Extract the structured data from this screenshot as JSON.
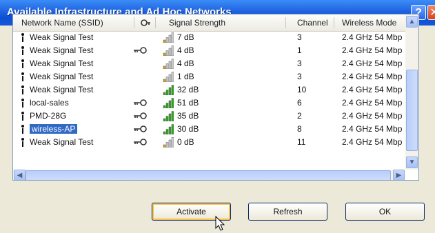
{
  "window": {
    "title": "Available Infrastructure and Ad Hoc Networks",
    "help_label": "?",
    "close_label": "✕"
  },
  "columns": {
    "ssid": "Network Name (SSID)",
    "signal": "Signal Strength",
    "channel": "Channel",
    "mode": "Wireless Mode"
  },
  "networks": [
    {
      "ssid": "Weak Signal Test",
      "secured": false,
      "signal": "7 dB",
      "level": 0.25,
      "strong": false,
      "channel": "3",
      "mode": "2.4 GHz 54 Mbp"
    },
    {
      "ssid": "Weak Signal Test",
      "secured": true,
      "signal": "4 dB",
      "level": 0.25,
      "strong": false,
      "channel": "1",
      "mode": "2.4 GHz 54 Mbp"
    },
    {
      "ssid": "Weak Signal Test",
      "secured": false,
      "signal": "4 dB",
      "level": 0.25,
      "strong": false,
      "channel": "3",
      "mode": "2.4 GHz 54 Mbp"
    },
    {
      "ssid": "Weak Signal Test",
      "secured": false,
      "signal": "1 dB",
      "level": 0.25,
      "strong": false,
      "channel": "3",
      "mode": "2.4 GHz 54 Mbp"
    },
    {
      "ssid": "Weak Signal Test",
      "secured": false,
      "signal": "32 dB",
      "level": 1,
      "strong": true,
      "channel": "10",
      "mode": "2.4 GHz 54 Mbp"
    },
    {
      "ssid": "local-sales",
      "secured": true,
      "signal": "51 dB",
      "level": 1,
      "strong": true,
      "channel": "6",
      "mode": "2.4 GHz 54 Mbp"
    },
    {
      "ssid": "PMD-28G",
      "secured": true,
      "signal": "35 dB",
      "level": 1,
      "strong": true,
      "channel": "2",
      "mode": "2.4 GHz 54 Mbp"
    },
    {
      "ssid": "wireless-AP",
      "secured": true,
      "signal": "30 dB",
      "level": 1,
      "strong": true,
      "channel": "8",
      "mode": "2.4 GHz 54 Mbp",
      "selected": true
    },
    {
      "ssid": "Weak Signal Test",
      "secured": true,
      "signal": "0 dB",
      "level": 0.25,
      "strong": false,
      "channel": "11",
      "mode": "2.4 GHz 54 Mbp"
    }
  ],
  "buttons": {
    "activate": "Activate",
    "refresh": "Refresh",
    "ok": "OK"
  },
  "colors": {
    "selection": "#316ac5",
    "strong_signal": "#2eaa1e",
    "weak_bar": "#d2d2d2",
    "weak_lit": "#e0a400"
  }
}
